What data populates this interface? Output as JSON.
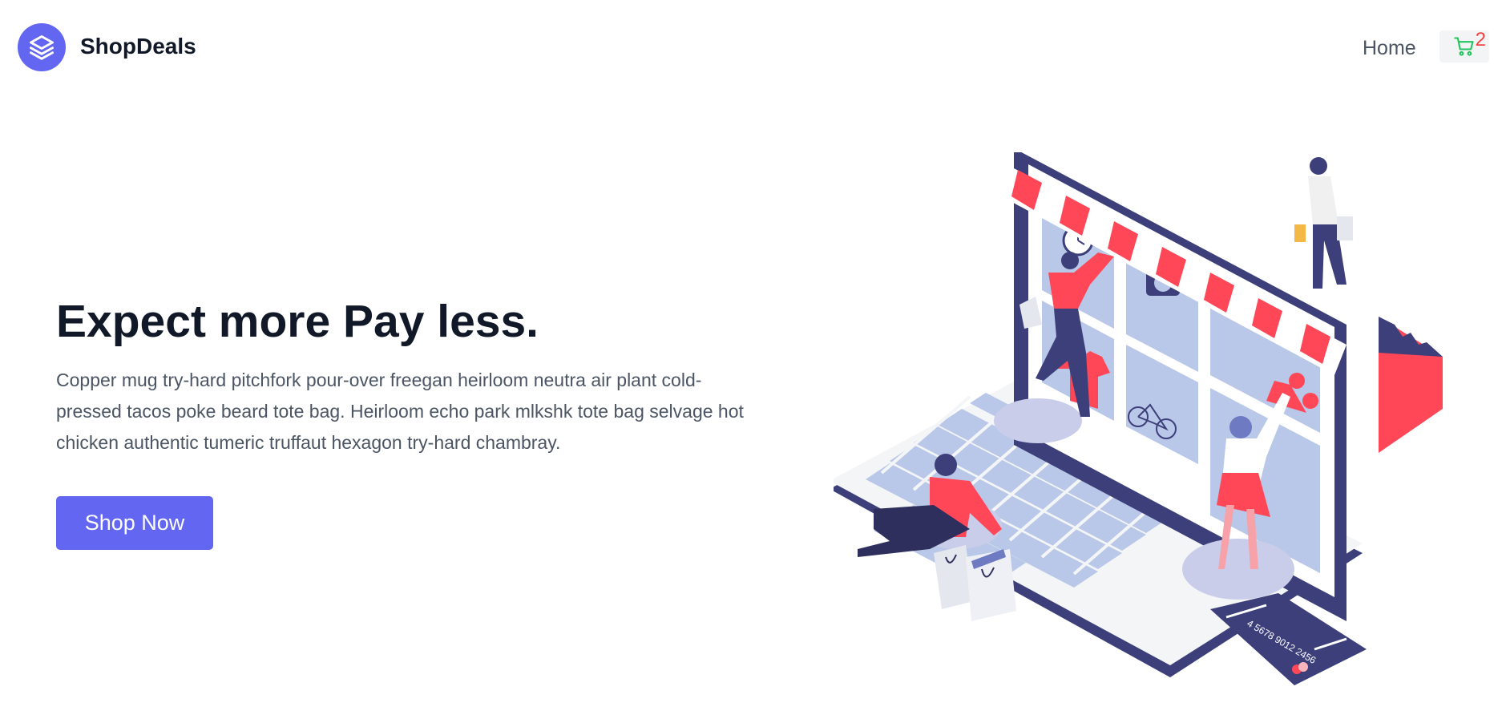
{
  "header": {
    "brand": "ShopDeals",
    "nav": {
      "home_label": "Home"
    },
    "cart": {
      "count": "2"
    }
  },
  "hero": {
    "title": "Expect more Pay less.",
    "description": "Copper mug try-hard pitchfork pour-over freegan heirloom neutra air plant cold-pressed tacos poke beard tote bag. Heirloom echo park mlkshk tote bag selvage hot chicken authentic tumeric truffaut hexagon try-hard chambray.",
    "cta_label": "Shop Now",
    "card_number": "4 5678 9012 2456"
  },
  "colors": {
    "accent": "#6366f1",
    "cart_icon": "#22c55e",
    "cart_count": "#ef4444",
    "illustration_red": "#ff4757",
    "illustration_navy": "#3d3f7a"
  },
  "icons": {
    "logo": "stack-layers-icon",
    "cart": "shopping-cart-icon"
  }
}
